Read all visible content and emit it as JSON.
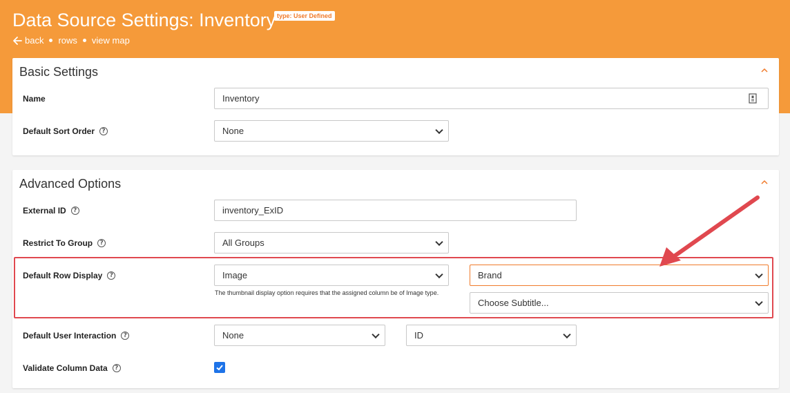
{
  "header": {
    "title": "Data Source Settings: Inventory",
    "type_badge": "type: User Defined",
    "nav": {
      "back": "back",
      "rows": "rows",
      "view_map": "view map"
    }
  },
  "basic": {
    "title": "Basic Settings",
    "name_label": "Name",
    "name_value": "Inventory",
    "sort_label": "Default Sort Order",
    "sort_value": "None"
  },
  "advanced": {
    "title": "Advanced Options",
    "external_id_label": "External ID",
    "external_id_value": "inventory_ExID",
    "restrict_label": "Restrict To Group",
    "restrict_value": "All Groups",
    "row_display_label": "Default Row Display",
    "row_display_value": "Image",
    "row_display_note": "The thumbnail display option requires that the assigned column be of Image type.",
    "title_column_value": "Brand",
    "subtitle_value": "Choose Subtitle...",
    "interaction_label": "Default User Interaction",
    "interaction_value": "None",
    "interaction_column_value": "ID",
    "validate_label": "Validate Column Data",
    "validate_checked": true
  },
  "colors": {
    "accent": "#f59a3a",
    "highlight": "#e0484f",
    "checkbox": "#1e73e8"
  }
}
